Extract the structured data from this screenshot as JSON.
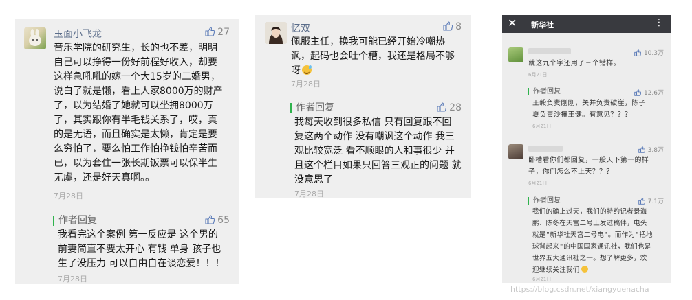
{
  "panel1": {
    "comment": {
      "username": "玉面小飞龙",
      "likes": "27",
      "lines": [
        "音乐学院的研究生，长的也不差，明明",
        "自己可以挣得一份好前程好收入，却要",
        "这样急吼吼的嫁一个大15岁的二婚男，",
        "说白了就是懒，看上人家8000万的财产",
        "了，以为结婚了她就可以坐拥8000万",
        "了，其实跟你有半毛钱关系了，哎，真",
        "的是无语，而且确实是太懒，肯定是要",
        "么穷怕了，要么怕工作怕挣钱怕辛苦而",
        "已，以为套住一张长期饭票可以保半生",
        "无虞，还是好天真啊。。"
      ],
      "date": "7月28日"
    },
    "reply": {
      "label": "作者回复",
      "likes": "65",
      "lines": [
        "我看完这个案例 第一反应是 这个男的",
        "前妻简直不要太开心 有钱 单身 孩子也",
        "生了没压力 可以自由自在谈恋爱！！！"
      ],
      "date": "7月28日"
    }
  },
  "panel2": {
    "comment": {
      "username": "忆双",
      "likes": "8",
      "lines": [
        "佩服主任，换我可能已经开始冷嘲热",
        "讽，起码也会吐个槽，我还是格局不够",
        "呀"
      ],
      "date": "7月28日"
    },
    "reply": {
      "label": "作者回复",
      "likes": "28",
      "lines": [
        "我每天收到很多私信  只有回复跟不回",
        "复这两个动作  没有嘲讽这个动作  我三",
        "观比较宽泛 看不顺眼的人和事很少 并",
        "且这个栏目如果只回答三观正的问题 就",
        "没意思了"
      ],
      "date": "7月28日"
    }
  },
  "panel3": {
    "title": "新华社",
    "close_icon": "✕",
    "more_icon": "⋮",
    "comment1": {
      "likes": "10.3万",
      "lines": [
        "就这九个字还用了三个错样。"
      ],
      "date": "6月21日"
    },
    "reply1": {
      "label": "作者回复",
      "likes": "12.6万",
      "lines": [
        "王毅负责刚刚，关并负责破崖，陈子",
        "夏负责沙揍王健。有意见？？？"
      ],
      "date": "6月21日"
    },
    "comment2": {
      "likes": "3.8万",
      "lines": [
        "卧槽看你们都回复，一般天下第一的样",
        "子，你们怎么不上天？？？"
      ],
      "date": "6月21日"
    },
    "reply2": {
      "label": "作者回复",
      "likes": "7.1万",
      "lines": [
        "我们的确上过天，我们的特约记者景海",
        "鹏、陈冬在天宫二号上发过稿件，电头",
        "就是\"新华社天宫二号电\"。而作为\"把地",
        "球背起来\"的中国国家通讯社，我们也是",
        "世界五大通讯社之一。想了解更多，欢",
        "迎继续关注我们"
      ],
      "date": "6月21日"
    }
  },
  "watermark": "https://blog.csdn.net/xiangyuenacha"
}
